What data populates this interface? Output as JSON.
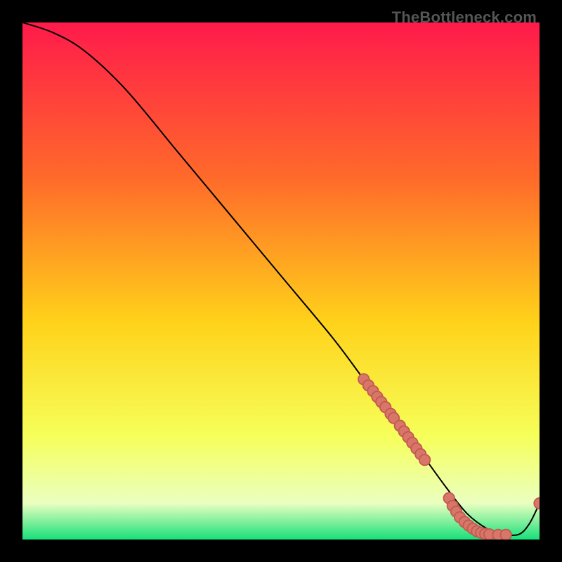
{
  "watermark": "TheBottleneck.com",
  "colors": {
    "top": "#ff1a4b",
    "upper_mid": "#ff6a2a",
    "mid": "#ffd21a",
    "lower_mid": "#f6ff5a",
    "pale": "#eaffc0",
    "bottom": "#17e07a",
    "curve": "#000000",
    "marker_fill": "#d9766a",
    "marker_stroke": "#c25a50"
  },
  "chart_data": {
    "type": "line",
    "title": "",
    "xlabel": "",
    "ylabel": "",
    "xlim": [
      0,
      100
    ],
    "ylim": [
      0,
      100
    ],
    "curve": {
      "x": [
        0,
        6,
        12,
        20,
        30,
        40,
        50,
        60,
        66,
        70,
        74,
        78,
        82,
        86,
        90,
        93,
        96,
        98,
        100
      ],
      "y": [
        100,
        98,
        94.5,
        87,
        75,
        63,
        51,
        39,
        31,
        26,
        21,
        15.5,
        10,
        5,
        2,
        1,
        1,
        3,
        7
      ]
    },
    "markers_upper_segment": {
      "x": [
        66.0,
        66.9,
        67.8,
        68.6,
        69.4,
        70.2,
        71.2,
        71.8,
        73.0,
        73.8,
        74.6,
        75.4,
        76.2,
        77.0,
        77.8
      ],
      "y": [
        31.0,
        29.8,
        28.7,
        27.6,
        26.6,
        25.6,
        24.3,
        23.5,
        22.0,
        20.9,
        19.8,
        18.7,
        17.6,
        16.5,
        15.4
      ]
    },
    "markers_trough": {
      "x": [
        82.5,
        83.2,
        83.9,
        84.6,
        85.5,
        86.3,
        87.1,
        87.9,
        88.7,
        89.5,
        90.3,
        92.0,
        93.5
      ],
      "y": [
        8.0,
        6.5,
        5.4,
        4.3,
        3.4,
        2.7,
        2.1,
        1.6,
        1.3,
        1.1,
        1.0,
        0.9,
        0.9
      ]
    },
    "markers_tail": {
      "x": [
        100
      ],
      "y": [
        7
      ]
    }
  }
}
